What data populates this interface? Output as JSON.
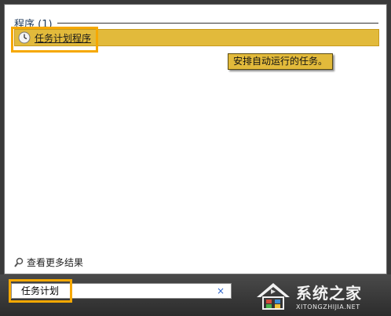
{
  "start_menu": {
    "section_title": "程序 (1)",
    "result": {
      "label": "任务计划程序",
      "icon": "clock-icon"
    },
    "tooltip": "安排自动运行的任务。",
    "see_more": "查看更多结果"
  },
  "search": {
    "value": "任务计划",
    "clear_symbol": "×"
  },
  "watermark": {
    "title": "系统之家",
    "url": "XITONGZHIJIA.NET"
  },
  "colors": {
    "highlight": "#e2ba3b",
    "annotation": "#f6a800",
    "link": "#1e395b"
  }
}
